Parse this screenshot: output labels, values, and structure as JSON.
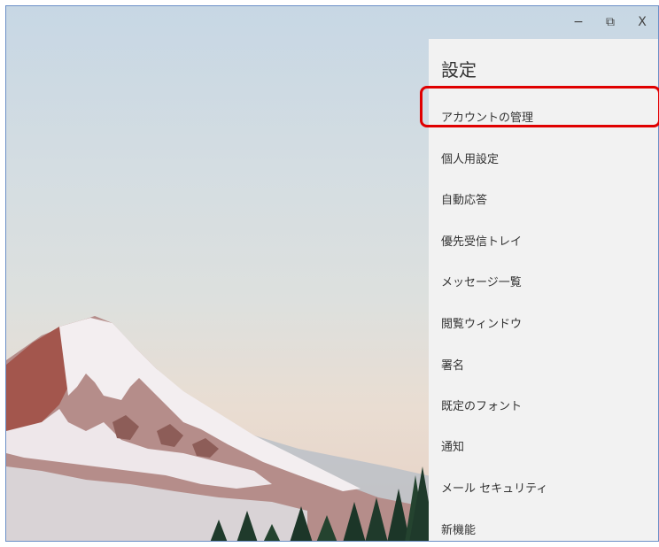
{
  "window": {
    "controls": {
      "minimize": "−",
      "restore": "⧉",
      "close": "X"
    }
  },
  "settings": {
    "title": "設定",
    "items": [
      {
        "label": "アカウントの管理",
        "selected": true
      },
      {
        "label": "個人用設定"
      },
      {
        "label": "自動応答"
      },
      {
        "label": "優先受信トレイ"
      },
      {
        "label": "メッセージ一覧"
      },
      {
        "label": "閲覧ウィンドウ"
      },
      {
        "label": "署名"
      },
      {
        "label": "既定のフォント"
      },
      {
        "label": "通知"
      },
      {
        "label": "メール セキュリティ"
      },
      {
        "label": "新機能"
      }
    ]
  },
  "colors": {
    "highlight": "#e00000",
    "panel": "#f2f2f2",
    "border": "#6b8fc7"
  }
}
